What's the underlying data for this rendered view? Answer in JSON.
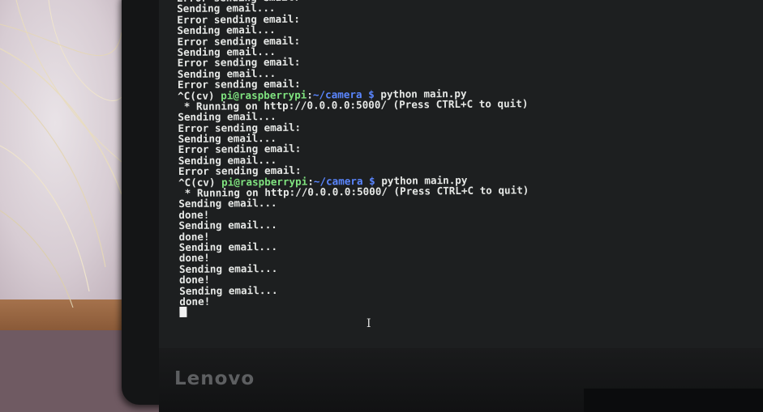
{
  "terminal": {
    "lines": [
      {
        "text": "Error sending email:"
      },
      {
        "text": "Sending email..."
      },
      {
        "text": "Error sending email:"
      },
      {
        "text": "Sending email..."
      },
      {
        "text": "Error sending email:"
      },
      {
        "text": "Sending email..."
      },
      {
        "text": "Error sending email:"
      },
      {
        "text": "Sending email..."
      },
      {
        "text": "Error sending email:"
      },
      {
        "prompt": {
          "prefix": "^C(cv) ",
          "user": "pi@raspberrypi",
          "sep": ":",
          "path": "~/camera",
          "dollar": " $",
          "command": " python main.py"
        }
      },
      {
        "text": " * Running on http://0.0.0.0:5000/ (Press CTRL+C to quit)"
      },
      {
        "text": "Sending email..."
      },
      {
        "text": "Error sending email:"
      },
      {
        "text": "Sending email..."
      },
      {
        "text": "Error sending email:"
      },
      {
        "text": "Sending email..."
      },
      {
        "text": "Error sending email:"
      },
      {
        "prompt": {
          "prefix": "^C(cv) ",
          "user": "pi@raspberrypi",
          "sep": ":",
          "path": "~/camera",
          "dollar": " $",
          "command": " python main.py"
        }
      },
      {
        "text": " * Running on http://0.0.0.0:5000/ (Press CTRL+C to quit)"
      },
      {
        "text": "Sending email..."
      },
      {
        "text": "done!"
      },
      {
        "text": "Sending email..."
      },
      {
        "text": "done!"
      },
      {
        "text": "Sending email..."
      },
      {
        "text": "done!"
      },
      {
        "text": "Sending email..."
      },
      {
        "text": "done!"
      },
      {
        "text": "Sending email..."
      },
      {
        "text": "done!"
      }
    ]
  },
  "monitor": {
    "brand": "Lenovo"
  },
  "colors": {
    "terminal_bg": "#1d1f20",
    "text": "#e6e8e6",
    "prompt_user": "#7fe27f",
    "prompt_path": "#5a86ff"
  },
  "icons": [
    "text-cursor-icon",
    "ibeam-pointer-icon"
  ]
}
